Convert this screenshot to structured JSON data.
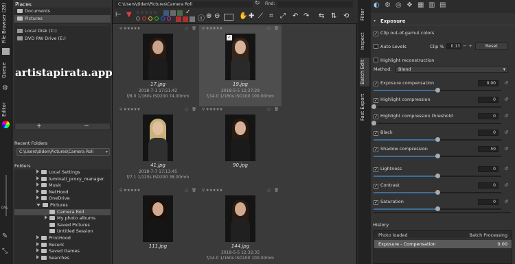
{
  "left_tabs": [
    "File Browser (28)",
    "Queue",
    "Editor"
  ],
  "left_zoom": "0%",
  "places": {
    "title": "Places",
    "items": [
      {
        "label": "Documents",
        "type": "folder"
      },
      {
        "label": "Pictures",
        "type": "folder",
        "selected": true
      },
      {
        "label": "Local Disk (C:)",
        "type": "drive"
      },
      {
        "label": "DVD RW Drive (E:)",
        "type": "drive"
      }
    ],
    "add_label": "+",
    "remove_label": "−"
  },
  "watermark": "artistapirata.app",
  "recent": {
    "title": "Recent Folders",
    "value": "C:\\Users\\diden\\Pictures\\Camera Roll"
  },
  "folders": {
    "title": "Folders",
    "items": [
      {
        "label": "Local Settings",
        "depth": 1,
        "expand": "right"
      },
      {
        "label": "luminati_proxy_manager",
        "depth": 1,
        "expand": "right"
      },
      {
        "label": "Music",
        "depth": 1,
        "expand": "right"
      },
      {
        "label": "NetHood",
        "depth": 1,
        "expand": "right"
      },
      {
        "label": "OneDrive",
        "depth": 1,
        "expand": "right"
      },
      {
        "label": "Pictures",
        "depth": 1,
        "expand": "down"
      },
      {
        "label": "Camera Roll",
        "depth": 2,
        "expand": "none",
        "selected": true
      },
      {
        "label": "My photo albums",
        "depth": 2,
        "expand": "right"
      },
      {
        "label": "Saved Pictures",
        "depth": 2,
        "expand": "none"
      },
      {
        "label": "Untitled Session",
        "depth": 2,
        "expand": "none"
      },
      {
        "label": "PrintHood",
        "depth": 1,
        "expand": "right"
      },
      {
        "label": "Recent",
        "depth": 1,
        "expand": "right"
      },
      {
        "label": "Saved Games",
        "depth": 1,
        "expand": "right"
      },
      {
        "label": "Searches",
        "depth": 1,
        "expand": "right"
      }
    ]
  },
  "browser": {
    "path": "C:\\Users\\diden\\Pictures\\Camera Roll",
    "find_label": "Find:",
    "thumbs": [
      {
        "name": "17.jpg",
        "date": "2018-7-1 17:51:42",
        "exif": "f/8.0 1/160s ISO200 74.00mm",
        "selected": false
      },
      {
        "name": "19.jpg",
        "date": "2018-5-5 12:37:29",
        "exif": "f/14.0 1/160s ISO100 100.00mm",
        "selected": true
      },
      {
        "name": "41.jpg",
        "date": "2018-7-7 17:13:45",
        "exif": "f/7.1 1/125s ISO200 38.00mm",
        "selected": false
      },
      {
        "name": "90.jpg",
        "date": "",
        "exif": "",
        "selected": false
      },
      {
        "name": "111.jpg",
        "date": "",
        "exif": "",
        "selected": false
      },
      {
        "name": "144.jpg",
        "date": "2018-5-5 12:32:35",
        "exif": "f/14.0 1/160s ISO100 100.00mm",
        "selected": false
      }
    ]
  },
  "right_tabs": [
    "Filter",
    "Inspect",
    "Batch Edit",
    "Fast Export"
  ],
  "tools": {
    "section": "Exposure",
    "clip_gamut": "Clip out-of-gamut colors",
    "auto_levels": "Auto Levels",
    "clip_pct_label": "Clip %",
    "clip_pct": "0.13",
    "reset": "Reset",
    "highlight_recon": "Highlight reconstruction",
    "method_label": "Method:",
    "method_value": "Blend",
    "params": [
      {
        "label": "Exposure compensation",
        "value": "0.00",
        "level": 0.5
      },
      {
        "label": "Highlight compression",
        "value": "0",
        "level": 0.0
      },
      {
        "label": "Highlight compression threshold",
        "value": "0",
        "level": 0.0
      },
      {
        "label": "Black",
        "value": "0",
        "level": 0.5
      },
      {
        "label": "Shadow compression",
        "value": "50",
        "level": 0.5
      },
      {
        "label": "Lightness",
        "value": "0",
        "level": 0.5
      },
      {
        "label": "Contrast",
        "value": "0",
        "level": 0.5
      },
      {
        "label": "Saturation",
        "value": "0",
        "level": 0.5
      }
    ]
  },
  "history": {
    "title": "History",
    "col1": "Photo loaded",
    "col2": "Batch Processing",
    "rows": [
      {
        "name": "Exposure - Compensation",
        "value": "0.00"
      }
    ]
  }
}
